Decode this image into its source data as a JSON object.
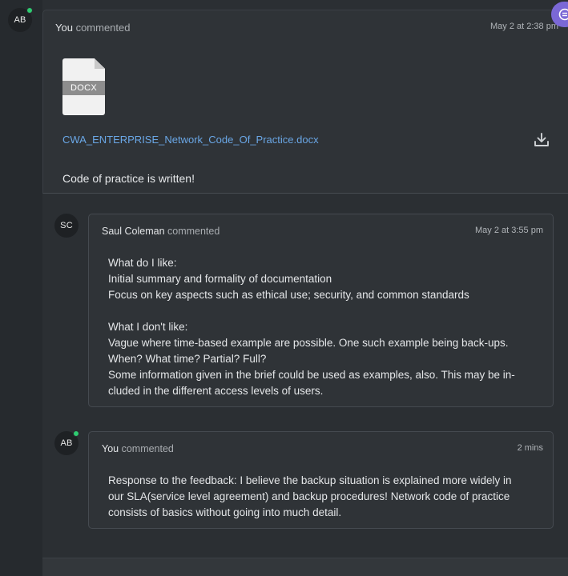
{
  "main_comment": {
    "avatar_initials": "AB",
    "author": "You",
    "verb": "commented",
    "timestamp": "May 2 at 2:38 pm",
    "attachment": {
      "type_label": "DOCX",
      "filename": "CWA_ENTERPRISE_Network_Code_Of_Practice.docx"
    },
    "text": "Code of practice is written!"
  },
  "replies": [
    {
      "avatar_initials": "SC",
      "author": "Saul Coleman",
      "verb": "commented",
      "timestamp": "May 2 at 3:55 pm",
      "text": "What do I like:\nInitial summary and formality of documentation\nFocus on key aspects such as ethical use; security, and common standards\n\nWhat I don't like:\nVague where time-based example are possible. One such example being back-ups.\nWhen? What time? Partial? Full?\nSome information given in the brief could be used as examples, also. This may be in-\ncluded in the different access levels of users."
    },
    {
      "avatar_initials": "AB",
      "author": "You",
      "verb": "commented",
      "timestamp": "2 mins",
      "text": "Response to the feedback: I believe the backup situation is explained more widely in\nour SLA(service level agreement) and backup procedures! Network code of practice\nconsists of basics without going into much detail."
    }
  ],
  "colors": {
    "accent": "#6aa7e6",
    "online": "#2ecc71",
    "chat_button": "#7b68d6"
  }
}
